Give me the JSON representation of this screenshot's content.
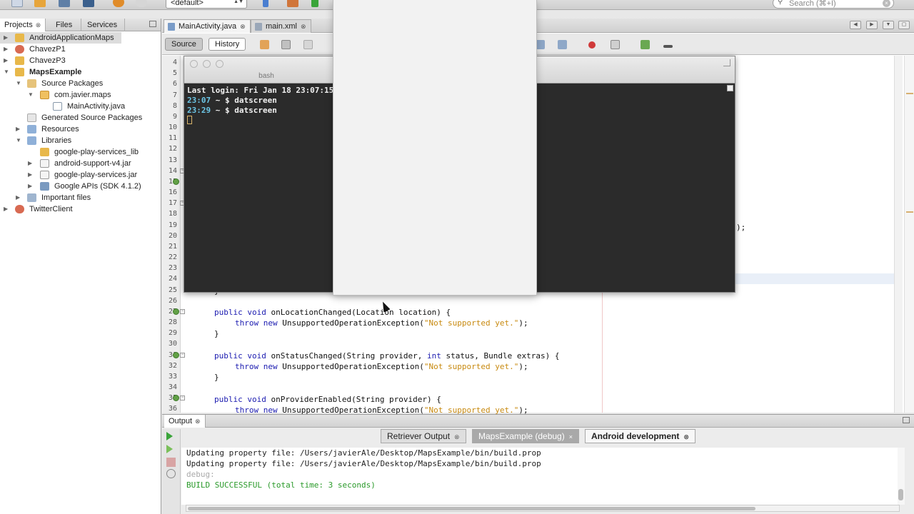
{
  "toolbar": {
    "config_value": "<default>",
    "search_placeholder": "Search (⌘+I)"
  },
  "left_panel": {
    "tabs": [
      "Projects",
      "Files",
      "Services"
    ],
    "tree": [
      {
        "label": "AndroidApplicationMaps",
        "bold": false
      },
      {
        "label": "ChavezP1",
        "bold": false
      },
      {
        "label": "ChavezP3",
        "bold": false
      },
      {
        "label": "MapsExample",
        "bold": true
      },
      {
        "label": "Source Packages",
        "bold": false
      },
      {
        "label": "com.javier.maps",
        "bold": false
      },
      {
        "label": "MainActivity.java",
        "bold": false
      },
      {
        "label": "Generated Source Packages",
        "bold": false
      },
      {
        "label": "Resources",
        "bold": false
      },
      {
        "label": "Libraries",
        "bold": false
      },
      {
        "label": "google-play-services_lib",
        "bold": false
      },
      {
        "label": "android-support-v4.jar",
        "bold": false
      },
      {
        "label": "google-play-services.jar",
        "bold": false
      },
      {
        "label": "Google APIs (SDK 4.1.2)",
        "bold": false
      },
      {
        "label": "Important files",
        "bold": false
      },
      {
        "label": "TwitterClient",
        "bold": false
      }
    ]
  },
  "editor": {
    "tabs": [
      "MainActivity.java",
      "main.xml"
    ],
    "modes": [
      "Source",
      "History"
    ],
    "line_numbers": [
      "4",
      "5",
      "6",
      "7",
      "8",
      "9",
      "10",
      "11",
      "12",
      "13",
      "14",
      "15",
      "16",
      "17",
      "18",
      "19",
      "20",
      "21",
      "22",
      "23",
      "24",
      "25",
      "26",
      "27",
      "28",
      "29",
      "30",
      "31",
      "32",
      "33",
      "34",
      "35",
      "36"
    ],
    "code": {
      "l27_kw": "public void ",
      "l27_fn": "onLocationChanged",
      "l27_rest": "(Location location) {",
      "l28_kw": "throw new ",
      "l28_mid": "UnsupportedOperationException(",
      "l28_str": "\"Not supported yet.\"",
      "l28_end": ");",
      "l29": "}",
      "l31_kw": "public void ",
      "l31_fn": "onStatusChanged",
      "l31_a": "(String provider, ",
      "l31_kw2": "int ",
      "l31_b": "status, Bundle extras) {",
      "l32_kw": "throw new ",
      "l32_mid": "UnsupportedOperationException(",
      "l32_str": "\"Not supported yet.\"",
      "l32_end": ");",
      "l33": "}",
      "l35_kw": "public void ",
      "l35_fn": "onProviderEnabled",
      "l35_rest": "(String provider) {",
      "l36_kw": "throw new ",
      "l36_mid": "UnsupportedOperationException(",
      "l36_str": "\"Not supported yet.\"",
      "l36_end": ");",
      "l25_frag": "}",
      "l20_frag": ");"
    }
  },
  "terminal": {
    "title": "bash",
    "line1": "Last login: Fri Jan 18 23:07:15 c",
    "l2_time": "23:07",
    "l2_rest": " ~ $ datscreen",
    "l3_time": "23:29",
    "l3_rest": " ~ $ datscreen"
  },
  "output": {
    "title": "Output",
    "tabs": [
      "Retriever Output",
      "MapsExample (debug)",
      "Android development"
    ],
    "lines": [
      "Updating property file: /Users/javierAle/Desktop/MapsExample/bin/build.prop",
      "Updating property file: /Users/javierAle/Desktop/MapsExample/bin/build.prop",
      "debug:",
      "BUILD SUCCESSFUL (total time: 3 seconds)"
    ]
  }
}
